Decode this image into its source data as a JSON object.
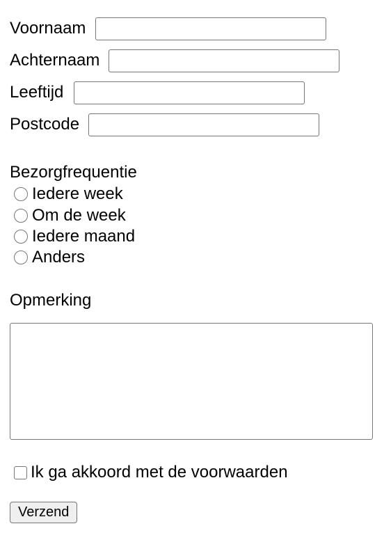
{
  "fields": {
    "first_name": {
      "label": "Voornaam",
      "value": ""
    },
    "last_name": {
      "label": "Achternaam",
      "value": ""
    },
    "age": {
      "label": "Leeftijd",
      "value": ""
    },
    "postal_code": {
      "label": "Postcode",
      "value": ""
    }
  },
  "frequency": {
    "heading": "Bezorgfrequentie",
    "options": [
      {
        "label": "Iedere week",
        "checked": false
      },
      {
        "label": "Om de week",
        "checked": false
      },
      {
        "label": "Iedere maand",
        "checked": false
      },
      {
        "label": "Anders",
        "checked": false
      }
    ]
  },
  "remark": {
    "heading": "Opmerking",
    "value": ""
  },
  "terms": {
    "label": "Ik ga akkoord met de voorwaarden",
    "checked": false
  },
  "submit": {
    "label": "Verzend"
  }
}
